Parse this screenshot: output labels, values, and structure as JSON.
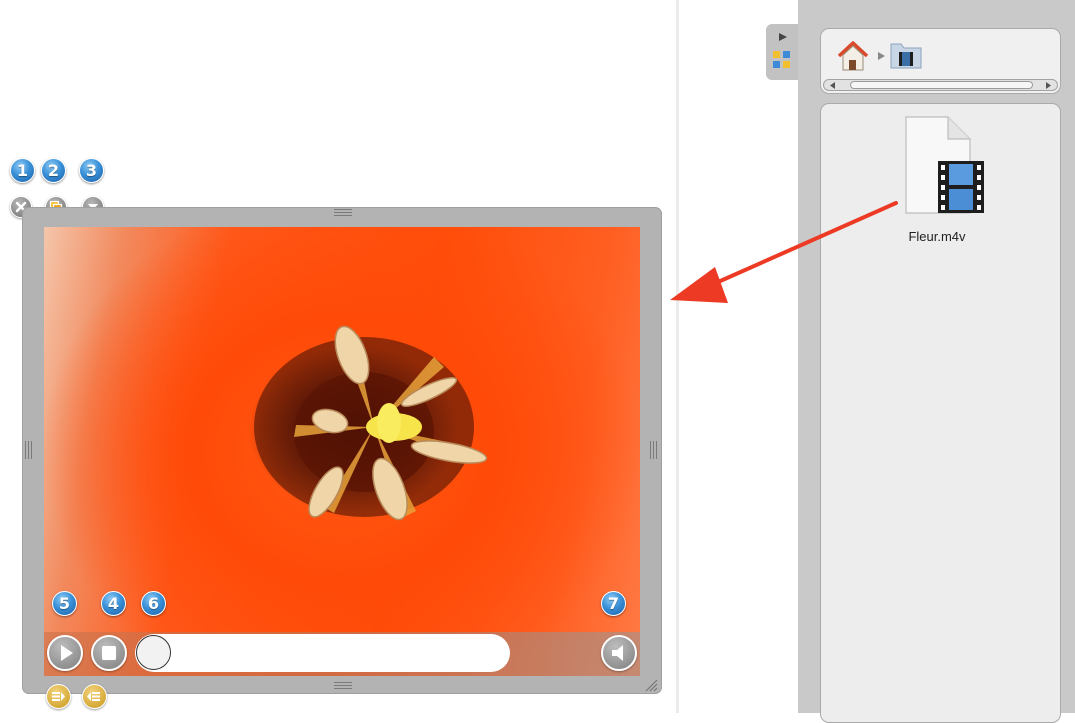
{
  "badges": {
    "top": [
      "1",
      "2",
      "3"
    ],
    "player": [
      "5",
      "4",
      "6"
    ],
    "volume": "7"
  },
  "browser": {
    "file_name": "Fleur.m4v"
  },
  "colors": {
    "badge_blue": "#3a91d8",
    "frame_grey": "#b3b3b3",
    "panel_grey": "#c9c9c9",
    "arrow_red": "#ec3a24"
  },
  "icons": {
    "close": "close-icon",
    "duplicate": "duplicate-icon",
    "menu": "chevron-down-icon",
    "play": "play-icon",
    "stop": "stop-icon",
    "volume": "speaker-icon",
    "home": "home-icon",
    "folder": "movie-folder-icon",
    "file": "video-file-icon"
  }
}
